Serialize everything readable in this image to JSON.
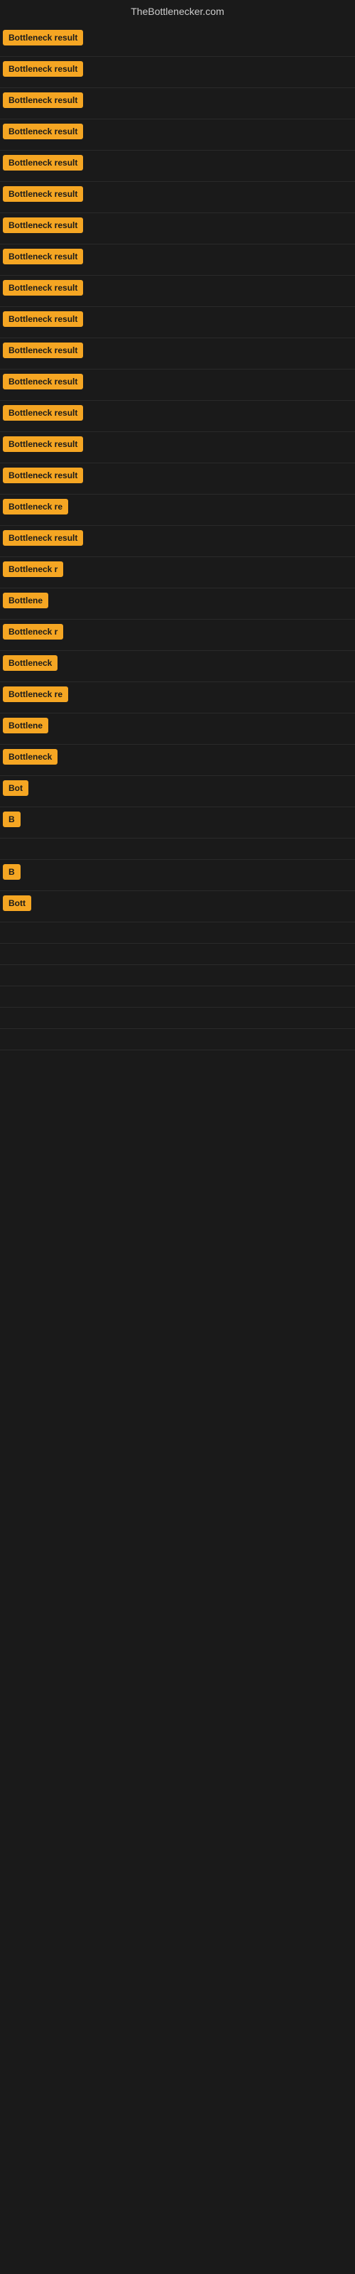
{
  "site": {
    "title": "TheBottlenecker.com"
  },
  "items": [
    {
      "id": 1,
      "label": "Bottleneck result",
      "width_class": "w-full"
    },
    {
      "id": 2,
      "label": "Bottleneck result",
      "width_class": "w-full"
    },
    {
      "id": 3,
      "label": "Bottleneck result",
      "width_class": "w-full"
    },
    {
      "id": 4,
      "label": "Bottleneck result",
      "width_class": "w-full"
    },
    {
      "id": 5,
      "label": "Bottleneck result",
      "width_class": "w-full"
    },
    {
      "id": 6,
      "label": "Bottleneck result",
      "width_class": "w-full"
    },
    {
      "id": 7,
      "label": "Bottleneck result",
      "width_class": "w-full"
    },
    {
      "id": 8,
      "label": "Bottleneck result",
      "width_class": "w-full"
    },
    {
      "id": 9,
      "label": "Bottleneck result",
      "width_class": "w-full"
    },
    {
      "id": 10,
      "label": "Bottleneck result",
      "width_class": "w-full"
    },
    {
      "id": 11,
      "label": "Bottleneck result",
      "width_class": "w-full"
    },
    {
      "id": 12,
      "label": "Bottleneck result",
      "width_class": "w-full"
    },
    {
      "id": 13,
      "label": "Bottleneck result",
      "width_class": "w-full"
    },
    {
      "id": 14,
      "label": "Bottleneck result",
      "width_class": "w-full"
    },
    {
      "id": 15,
      "label": "Bottleneck result",
      "width_class": "w-full"
    },
    {
      "id": 16,
      "label": "Bottleneck re",
      "width_class": "w-lg"
    },
    {
      "id": 17,
      "label": "Bottleneck result",
      "width_class": "w-full"
    },
    {
      "id": 18,
      "label": "Bottleneck r",
      "width_class": "w-md"
    },
    {
      "id": 19,
      "label": "Bottlene",
      "width_class": "w-sm"
    },
    {
      "id": 20,
      "label": "Bottleneck r",
      "width_class": "w-md"
    },
    {
      "id": 21,
      "label": "Bottleneck",
      "width_class": "w-sm"
    },
    {
      "id": 22,
      "label": "Bottleneck re",
      "width_class": "w-lg"
    },
    {
      "id": 23,
      "label": "Bottlene",
      "width_class": "w-sm"
    },
    {
      "id": 24,
      "label": "Bottleneck",
      "width_class": "w-sm"
    },
    {
      "id": 25,
      "label": "Bot",
      "width_class": "w-xs"
    },
    {
      "id": 26,
      "label": "B",
      "width_class": "w-xxxs"
    },
    {
      "id": 27,
      "label": "",
      "width_class": "w-tiny"
    },
    {
      "id": 28,
      "label": "B",
      "width_class": "w-xxxs"
    },
    {
      "id": 29,
      "label": "Bott",
      "width_class": "w-xs"
    },
    {
      "id": 30,
      "label": "",
      "width_class": "w-tiny"
    },
    {
      "id": 31,
      "label": "",
      "width_class": "w-tiny"
    },
    {
      "id": 32,
      "label": "",
      "width_class": "w-tiny"
    },
    {
      "id": 33,
      "label": "",
      "width_class": "w-tiny"
    },
    {
      "id": 34,
      "label": "",
      "width_class": "w-tiny"
    },
    {
      "id": 35,
      "label": "",
      "width_class": "w-tiny"
    }
  ]
}
